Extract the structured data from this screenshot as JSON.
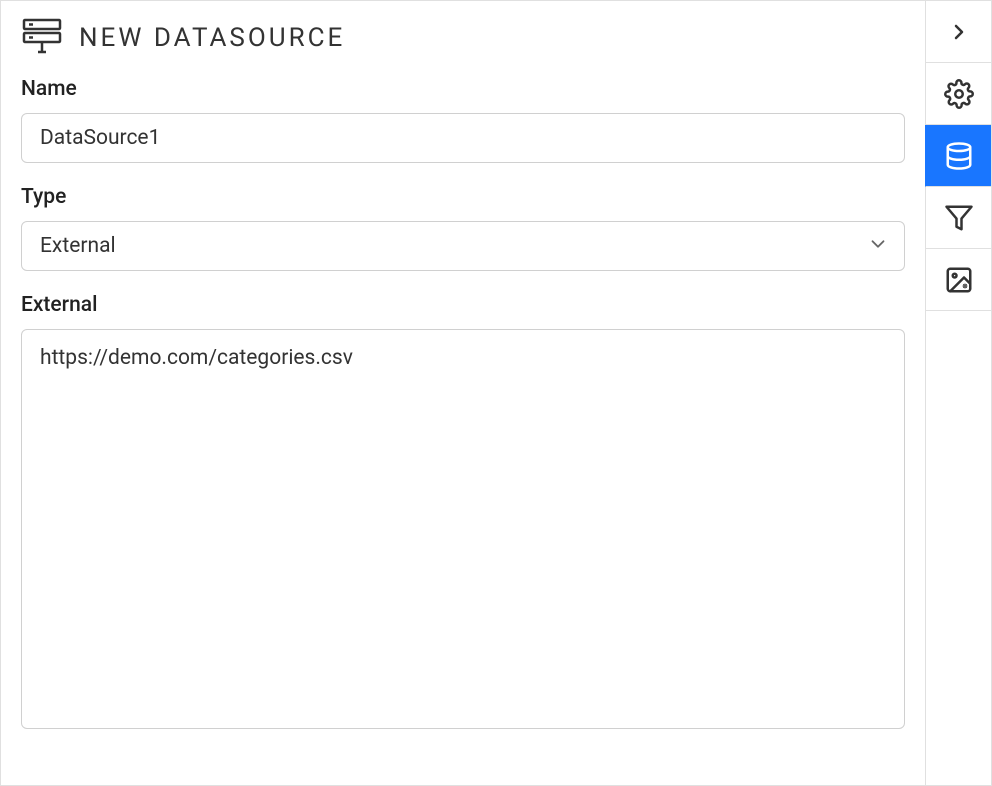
{
  "page_title": "NEW DATASOURCE",
  "form": {
    "name_label": "Name",
    "name_value": "DataSource1",
    "type_label": "Type",
    "type_value": "External",
    "external_label": "External",
    "external_value": "https://demo.com/categories.csv"
  },
  "sidebar": {
    "active_index": 2
  }
}
